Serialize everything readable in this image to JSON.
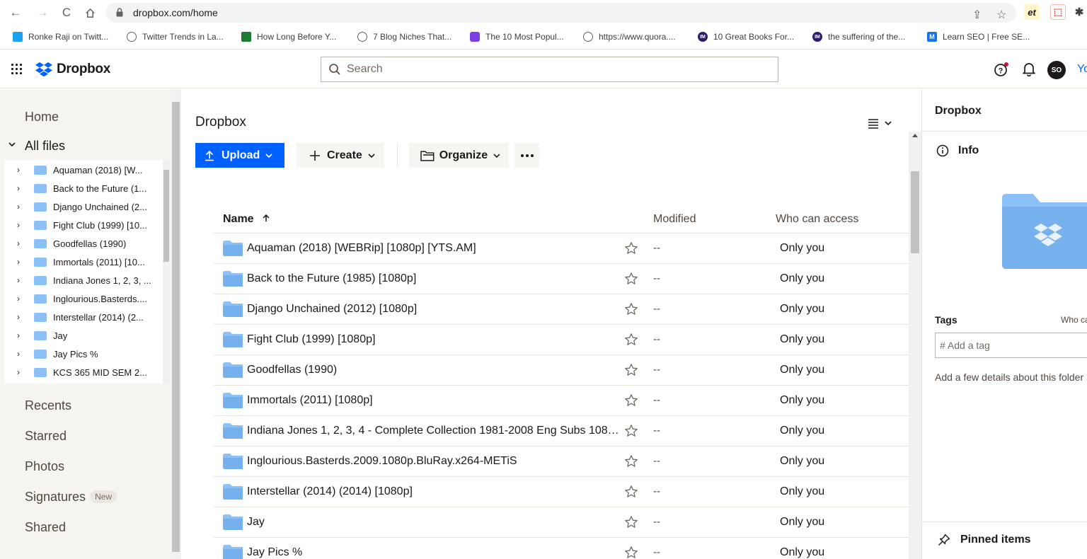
{
  "browser": {
    "url": "dropbox.com/home",
    "bookmarks": [
      {
        "label": "Ronke Raji on Twitt...",
        "icon": "twitter-icon",
        "color": "#1da1f2"
      },
      {
        "label": "Twitter Trends in La...",
        "icon": "globe-icon",
        "color": "#5f6368"
      },
      {
        "label": "How Long Before Y...",
        "icon": "chart-icon",
        "color": "#1e7b34"
      },
      {
        "label": "7 Blog Niches That...",
        "icon": "globe-icon",
        "color": "#5f6368"
      },
      {
        "label": "The 10 Most Popul...",
        "icon": "purple-square-icon",
        "color": "#7b3fe4"
      },
      {
        "label": "https://www.quora....",
        "icon": "globe-icon",
        "color": "#5f6368"
      },
      {
        "label": "10 Great Books For...",
        "icon": "im-icon",
        "color": "#2d1b69",
        "text": "IM"
      },
      {
        "label": "the suffering of the...",
        "icon": "im-icon",
        "color": "#2d1b69",
        "text": "IM"
      },
      {
        "label": "Learn SEO | Free SE...",
        "icon": "m-icon",
        "color": "#1a73e8",
        "text": "M"
      }
    ]
  },
  "header": {
    "logo_text": "Dropbox",
    "search_placeholder": "Search",
    "avatar_initials": "SO",
    "account_label": "Yo"
  },
  "leftnav": {
    "home": "Home",
    "all_files": "All files",
    "tree": [
      "Aquaman (2018) [W...",
      "Back to the Future (1...",
      "Django Unchained (2...",
      "Fight Club (1999) [10...",
      "Goodfellas (1990)",
      "Immortals (2011) [10...",
      "Indiana Jones 1, 2, 3, ...",
      "Inglourious.Basterds....",
      "Interstellar (2014) (2...",
      "Jay",
      "Jay Pics %",
      "KCS 365 MID SEM 2..."
    ],
    "recents": "Recents",
    "starred": "Starred",
    "photos": "Photos",
    "signatures": "Signatures",
    "signatures_badge": "New",
    "shared": "Shared"
  },
  "main": {
    "title": "Dropbox",
    "upload": "Upload",
    "create": "Create",
    "organize": "Organize",
    "columns": {
      "name": "Name",
      "modified": "Modified",
      "access": "Who can access"
    },
    "files": [
      {
        "name": "Aquaman (2018) [WEBRip] [1080p] [YTS.AM]",
        "modified": "--",
        "access": "Only you"
      },
      {
        "name": "Back to the Future (1985) [1080p]",
        "modified": "--",
        "access": "Only you"
      },
      {
        "name": "Django Unchained (2012) [1080p]",
        "modified": "--",
        "access": "Only you"
      },
      {
        "name": "Fight Club (1999) [1080p]",
        "modified": "--",
        "access": "Only you"
      },
      {
        "name": "Goodfellas (1990)",
        "modified": "--",
        "access": "Only you"
      },
      {
        "name": "Immortals (2011) [1080p]",
        "modified": "--",
        "access": "Only you"
      },
      {
        "name": "Indiana Jones 1, 2, 3, 4 - Complete Collection 1981-2008 Eng Subs 1080...",
        "modified": "--",
        "access": "Only you"
      },
      {
        "name": "Inglourious.Basterds.2009.1080p.BluRay.x264-METiS",
        "modified": "--",
        "access": "Only you"
      },
      {
        "name": "Interstellar (2014) (2014) [1080p]",
        "modified": "--",
        "access": "Only you"
      },
      {
        "name": "Jay",
        "modified": "--",
        "access": "Only you"
      },
      {
        "name": "Jay Pics %",
        "modified": "--",
        "access": "Only you"
      }
    ]
  },
  "info_panel": {
    "title": "Dropbox",
    "tab": "Info",
    "tags_label": "Tags",
    "who_label": "Who ca",
    "tag_placeholder": "# Add a tag",
    "description": "Add a few details about this folder l",
    "pinned": "Pinned items"
  },
  "colors": {
    "accent": "#0061fe",
    "folder": "#8bc1f7",
    "folder_dark": "#76b1ee"
  }
}
